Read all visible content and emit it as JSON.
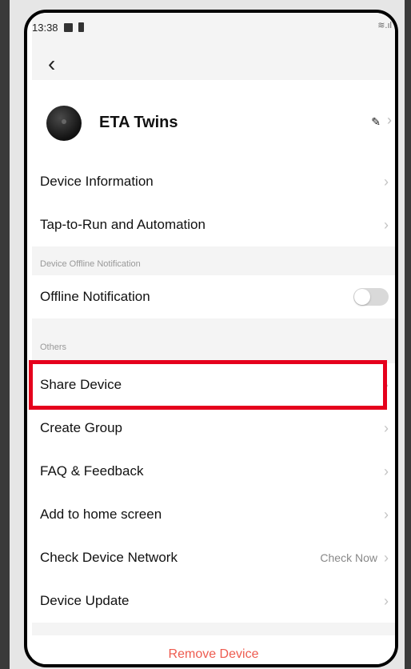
{
  "status_bar": {
    "time": "13:38"
  },
  "header": {
    "device_name": "ETA Twins"
  },
  "menu": {
    "device_information": "Device Information",
    "tap_to_run": "Tap-to-Run and Automation"
  },
  "offline_section": {
    "label": "Device Offline Notification",
    "offline_notification": "Offline Notification",
    "toggle_on": false
  },
  "others_section": {
    "label": "Others",
    "share_device": "Share Device",
    "create_group": "Create Group",
    "faq": "FAQ & Feedback",
    "add_home": "Add to home screen",
    "check_network": "Check Device Network",
    "check_now": "Check Now",
    "device_update": "Device Update"
  },
  "footer": {
    "remove_device": "Remove Device"
  },
  "colors": {
    "highlight": "#e5001c",
    "remove": "#ee5b4f"
  }
}
